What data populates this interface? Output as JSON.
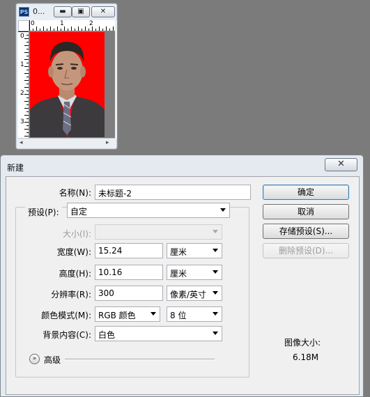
{
  "document_window": {
    "app_icon": "PS",
    "title": "0...",
    "minimize": "▬",
    "maximize": "▣",
    "close": "✕",
    "ruler_h": [
      "0",
      "1",
      "2"
    ],
    "ruler_v": [
      "0",
      "1",
      "2",
      "3"
    ]
  },
  "dialog": {
    "title": "新建",
    "close": "✕",
    "name_label": "名称(N):",
    "name_value": "未标题-2",
    "preset_label": "预设(P):",
    "preset_value": "自定",
    "size_label": "大小(I):",
    "size_value": "",
    "width_label": "宽度(W):",
    "width_value": "15.24",
    "width_unit": "厘米",
    "height_label": "高度(H):",
    "height_value": "10.16",
    "height_unit": "厘米",
    "resolution_label": "分辨率(R):",
    "resolution_value": "300",
    "resolution_unit": "像素/英寸",
    "color_mode_label": "颜色模式(M):",
    "color_mode_value": "RGB 颜色",
    "bit_depth_value": "8 位",
    "background_label": "背景内容(C):",
    "background_value": "白色",
    "advanced_label": "高级",
    "ok_button": "确定",
    "cancel_button": "取消",
    "save_preset_button": "存储预设(S)...",
    "delete_preset_button": "删除预设(D)...",
    "image_size_label": "图像大小:",
    "image_size_value": "6.18M"
  },
  "colors": {
    "photo_background": "#ff0000",
    "workspace": "#7b7b7b"
  },
  "icons": [
    "photoshop-app-icon",
    "minimize-icon",
    "maximize-icon",
    "close-icon",
    "dropdown-caret-icon",
    "chevron-double-down-icon"
  ]
}
